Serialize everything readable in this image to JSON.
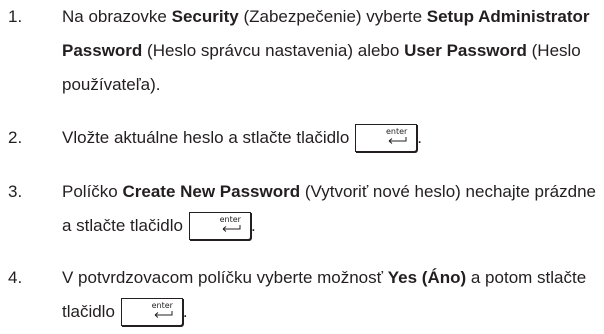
{
  "steps": [
    {
      "number": "1.",
      "t1": "Na obrazovke ",
      "b1": "Security",
      "t2": " (Zabezpečenie) vyberte ",
      "b2": "Setup Administrator Password",
      "t3": " (Heslo správcu nastavenia) alebo ",
      "b3": "User Password",
      "t4": " (Heslo používateľa)."
    },
    {
      "number": "2.",
      "t1": "Vložte aktuálne heslo a stlačte tlačidlo",
      "key": "enter",
      "t2": "."
    },
    {
      "number": "3.",
      "t1": "Políčko ",
      "b1": "Create New Password",
      "t2": " (Vytvoriť nové heslo) nechajte prázdne a stlačte tlačidlo",
      "key": "enter",
      "t3": "."
    },
    {
      "number": "4.",
      "t1": "V potvrdzovacom políčku vyberte možnosť ",
      "b1": "Yes (Áno)",
      "t2": " a potom stlačte tlačidlo",
      "key": "enter",
      "t3": "."
    }
  ]
}
